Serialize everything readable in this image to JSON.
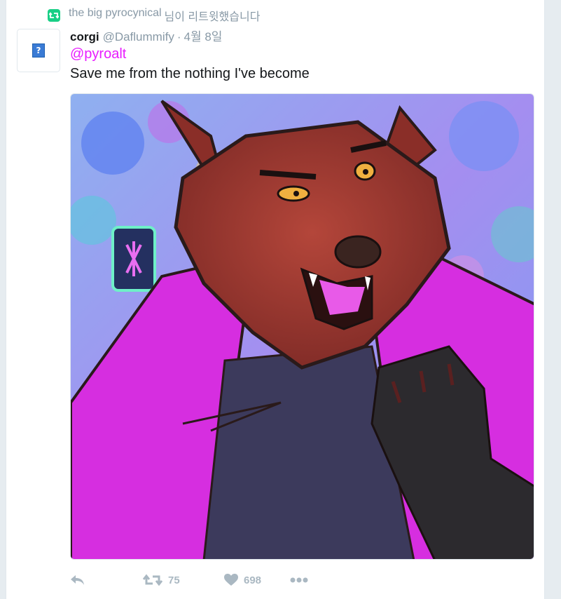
{
  "retweet_bar": {
    "retweeter": "the big pyrocynical",
    "suffix": "님이 리트윗했습니다",
    "icon": "retweet-icon",
    "icon_color": "#19cf86"
  },
  "tweet": {
    "avatar_icon": "missing-image-icon",
    "display_name": "corgi",
    "username": "@Daflummify",
    "separator": "·",
    "date": "4월 8일",
    "mention": "@pyroalt",
    "mention_color": "#e81cff",
    "text": "Save me from the nothing I've become",
    "media_description_icon": "photo-image"
  },
  "actions": {
    "reply_icon": "reply-icon",
    "retweet_icon": "retweet-icon",
    "retweet_count": "75",
    "like_icon": "heart-icon",
    "like_count": "698",
    "more_icon": "more-dots-icon",
    "icon_color": "#aab8c2"
  }
}
